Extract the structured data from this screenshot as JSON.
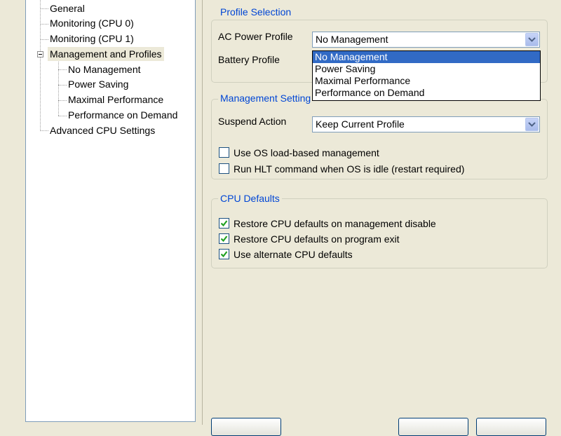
{
  "tree": {
    "items": [
      {
        "label": "General"
      },
      {
        "label": "Monitoring (CPU 0)"
      },
      {
        "label": "Monitoring (CPU 1)"
      },
      {
        "label": "Management and Profiles",
        "selected": true,
        "expanded": true,
        "children": [
          {
            "label": "No Management"
          },
          {
            "label": "Power Saving"
          },
          {
            "label": "Maximal Performance"
          },
          {
            "label": "Performance on Demand"
          }
        ]
      },
      {
        "label": "Advanced CPU Settings"
      }
    ]
  },
  "profile_selection": {
    "title": "Profile Selection",
    "ac_label": "AC Power Profile",
    "ac_value": "No Management",
    "battery_label": "Battery Profile",
    "dropdown_open": true,
    "options": [
      "No Management",
      "Power Saving",
      "Maximal Performance",
      "Performance on Demand"
    ],
    "highlighted_option": "No Management"
  },
  "management_settings": {
    "title": "Management Setting",
    "suspend_label": "Suspend Action",
    "suspend_value": "Keep Current Profile",
    "checkboxes": [
      {
        "label": "Use OS load-based management",
        "checked": false
      },
      {
        "label": "Run HLT command when OS is idle (restart required)",
        "checked": false
      }
    ]
  },
  "cpu_defaults": {
    "title": "CPU Defaults",
    "checkboxes": [
      {
        "label": "Restore CPU defaults on management disable",
        "checked": true
      },
      {
        "label": "Restore CPU defaults on program exit",
        "checked": true
      },
      {
        "label": "Use alternate CPU defaults",
        "checked": true
      }
    ]
  },
  "colors": {
    "window_bg": "#ECE9D8",
    "group_title": "#0046D5",
    "selection": "#316AC5",
    "check": "#21A121"
  }
}
